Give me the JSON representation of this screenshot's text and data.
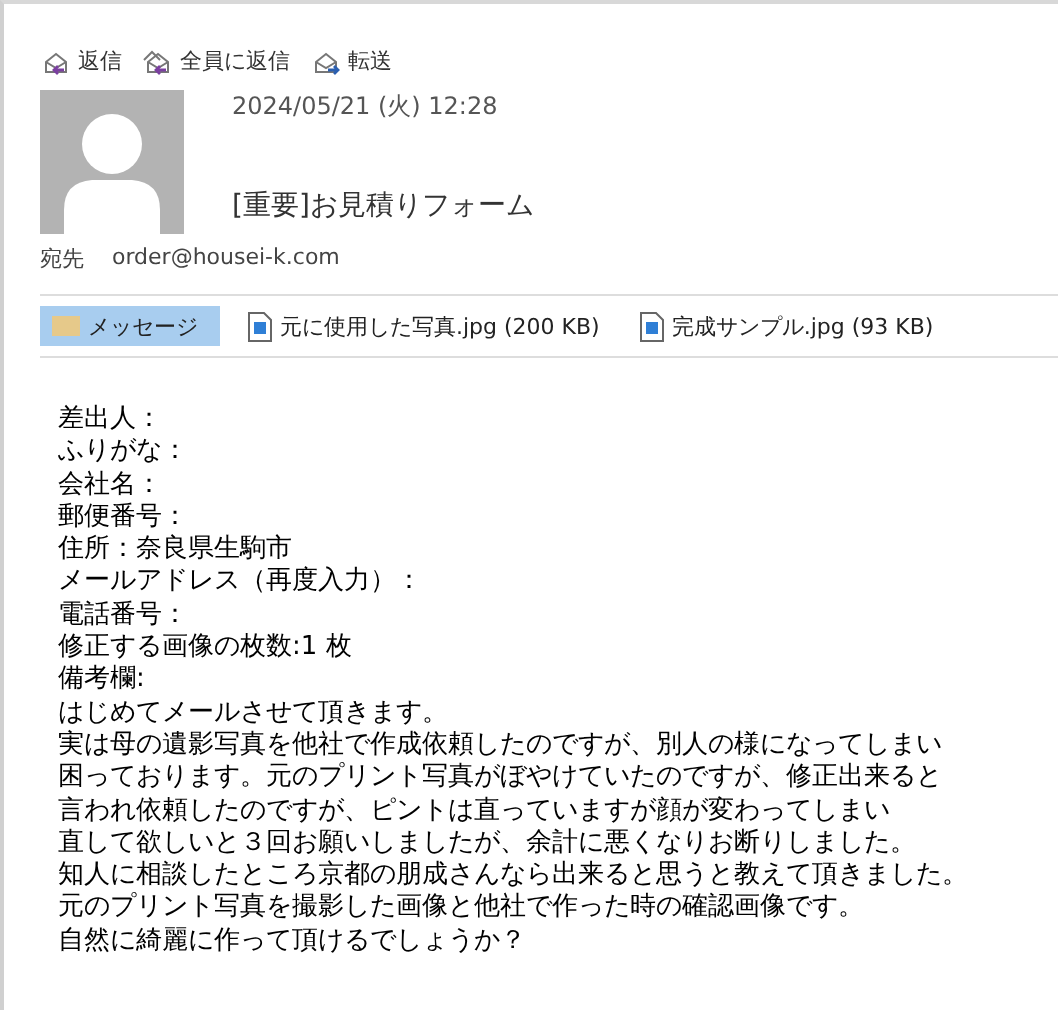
{
  "actions": [
    {
      "kind": "reply",
      "label": "返信"
    },
    {
      "kind": "reply_all",
      "label": "全員に返信"
    },
    {
      "kind": "forward",
      "label": "転送"
    }
  ],
  "header": {
    "date": "2024/05/21 (火) 12:28",
    "subject": "[重要]お見積りフォーム",
    "to_label": "宛先",
    "to": "order@housei-k.com"
  },
  "attachments": [
    {
      "kind": "message",
      "label": "メッセージ",
      "selected": true
    },
    {
      "kind": "file",
      "label": "元に使用した写真.jpg (200 KB)",
      "selected": false
    },
    {
      "kind": "file",
      "label": "完成サンプル.jpg (93 KB)",
      "selected": false
    }
  ],
  "body": [
    "差出人：",
    "ふりがな：",
    "会社名：",
    "郵便番号：",
    "住所：奈良県生駒市",
    "メールアドレス（再度入力）：",
    "電話番号：",
    "修正する画像の枚数:1 枚",
    "備考欄:",
    "はじめてメールさせて頂きます。",
    "実は母の遺影写真を他社で作成依頼したのですが、別人の様になってしまい",
    "困っております。元のプリント写真がぼやけていたのですが、修正出来ると",
    "言われ依頼したのですが、ピントは直っていますが顔が変わってしまい",
    "直して欲しいと３回お願いしましたが、余計に悪くなりお断りしました。",
    "知人に相談したところ京都の朋成さんなら出来ると思うと教えて頂きました。",
    "元のプリント写真を撮影した画像と他社で作った時の確認画像です。",
    "自然に綺麗に作って頂けるでしょうか？"
  ]
}
